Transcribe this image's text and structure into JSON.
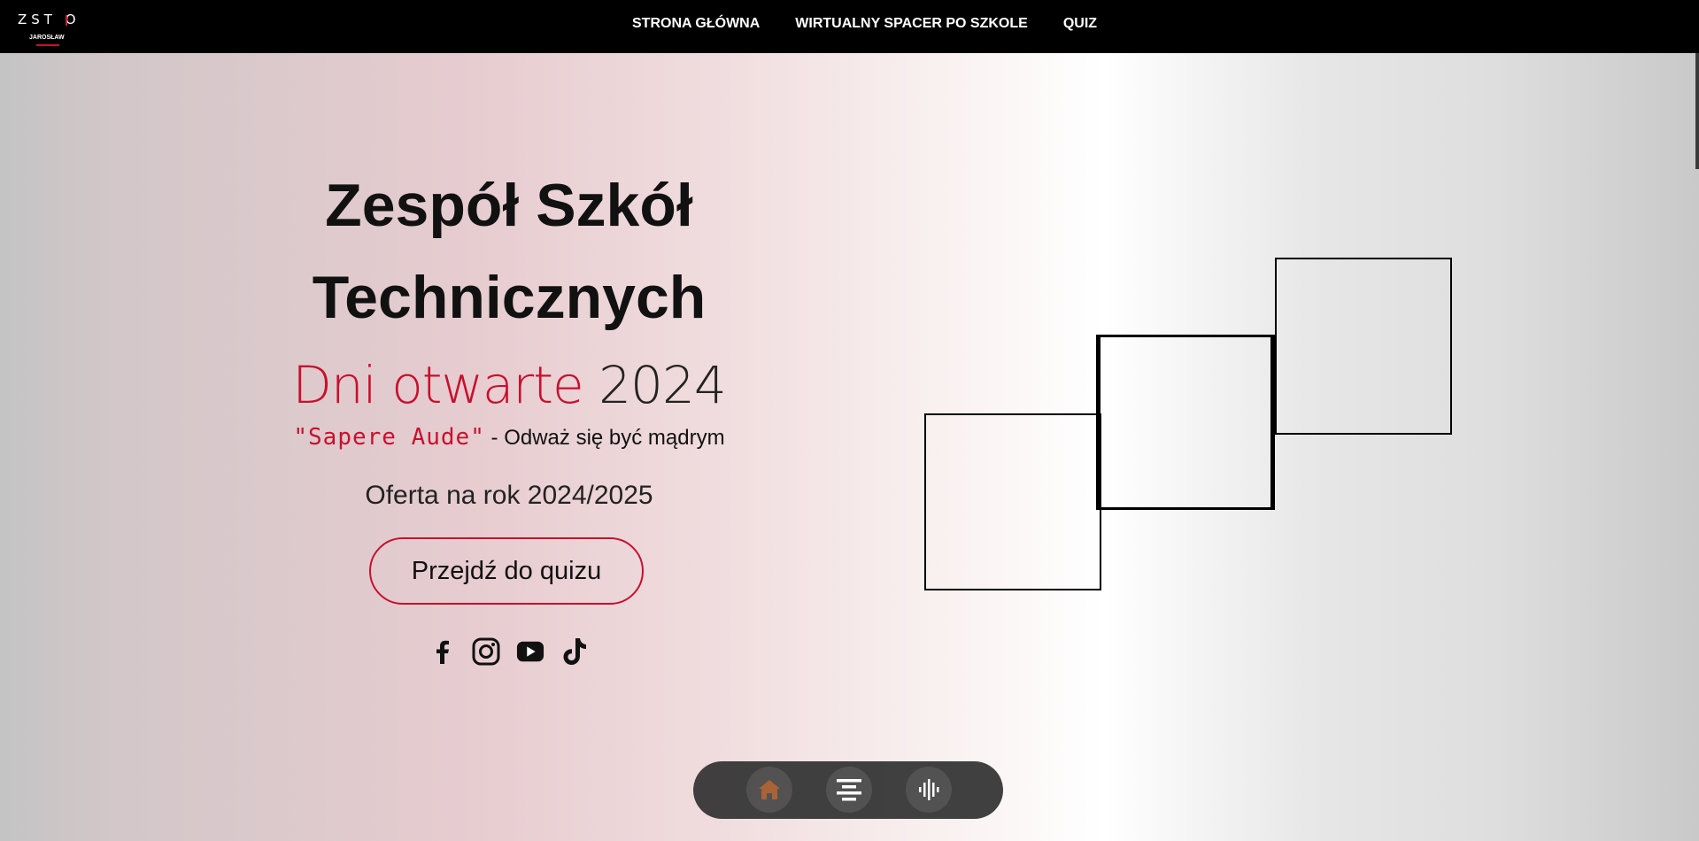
{
  "nav": {
    "logo_text": "ZST O",
    "logo_subtext": "JAROSŁAW",
    "links": [
      {
        "label": "STRONA GŁÓWNA"
      },
      {
        "label": "WIRTUALNY SPACER PO SZKOLE"
      },
      {
        "label": "QUIZ"
      }
    ]
  },
  "hero": {
    "title": "Zespół Szkół Technicznych",
    "subtitle_accent": "Dni otwarte",
    "subtitle_year": "2024",
    "motto_latin": "\"Sapere Aude\"",
    "motto_translation": "- Odważ się być mądrym",
    "offer_text": "Oferta na rok",
    "offer_year": "2024/2025",
    "quiz_button_label": "Przejdź do quizu"
  },
  "socials": [
    {
      "icon": "facebook-icon"
    },
    {
      "icon": "instagram-icon"
    },
    {
      "icon": "youtube-icon"
    },
    {
      "icon": "tiktok-icon"
    }
  ],
  "dock": [
    {
      "icon": "home-icon"
    },
    {
      "icon": "align-center-icon"
    },
    {
      "icon": "audio-wave-icon"
    }
  ],
  "colors": {
    "accent": "#c8102e",
    "navbar": "#000000",
    "dock": "#333333",
    "home_icon": "#a45a2a"
  }
}
